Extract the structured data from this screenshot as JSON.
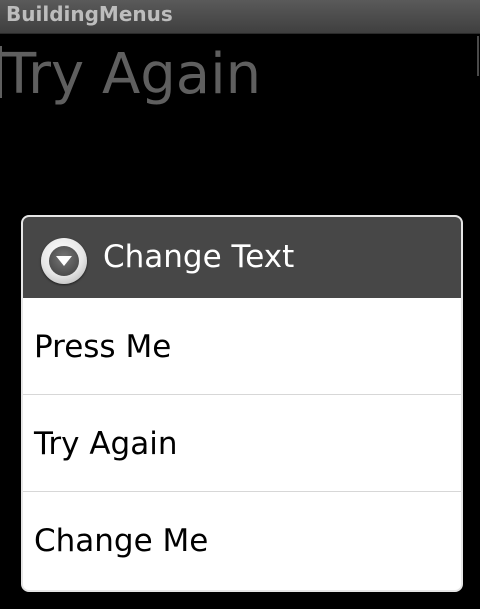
{
  "app": {
    "title": "BuildingMenus"
  },
  "main": {
    "text": "Try Again"
  },
  "context_menu": {
    "title": "Change Text",
    "header_icon": "circle-arrow-down-icon",
    "items": [
      {
        "label": "Press Me"
      },
      {
        "label": "Try Again"
      },
      {
        "label": "Change Me"
      }
    ]
  },
  "colors": {
    "background": "#000000",
    "title_bar": "#4a4a4a",
    "title_text": "#bdbdbd",
    "main_text": "#5f5f5f",
    "menu_header": "#474747",
    "menu_background": "#ffffff",
    "divider": "#d7d7d7"
  }
}
